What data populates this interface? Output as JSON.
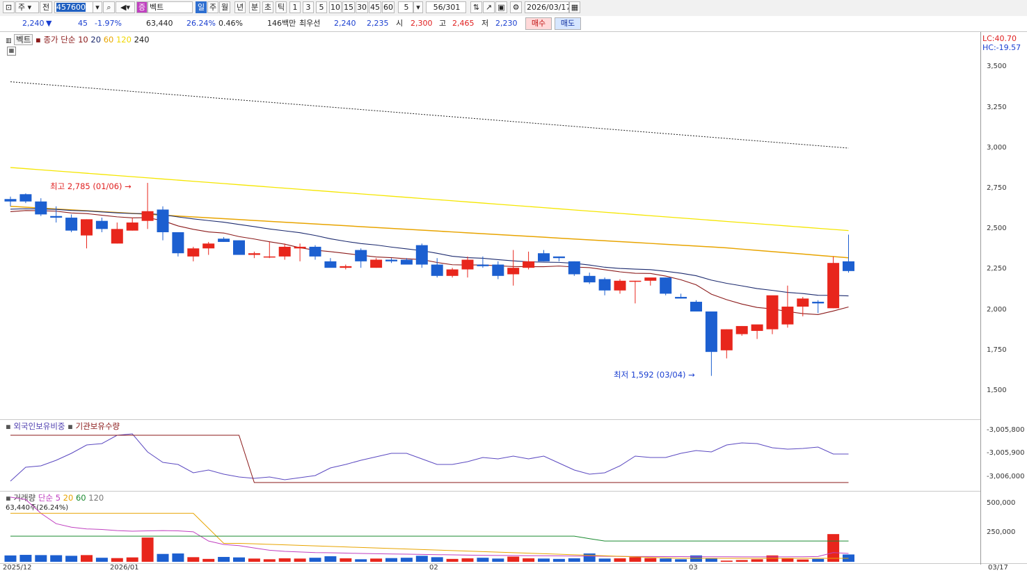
{
  "toolbar": {
    "market": "주",
    "prev_label": "전",
    "code": "457600",
    "name": "벡트",
    "name_prefix": "증",
    "periods": [
      "일",
      "주",
      "월",
      "년",
      "분",
      "초",
      "틱"
    ],
    "intervals": [
      "1",
      "3",
      "5",
      "10",
      "15",
      "30",
      "45",
      "60"
    ],
    "interval_value": "5",
    "count": "56",
    "total": "/301",
    "date": "2026/03/17"
  },
  "quote": {
    "price": "2,240",
    "arrow": "▼",
    "change": "45",
    "change_pct": "-1.97%",
    "volume": "63,440",
    "vol_pct": "26.24%",
    "turnover_pct": "0.46%",
    "amount": "146백만",
    "best_label": "최우선",
    "best_ask": "2,240",
    "best_bid": "2,235",
    "open_label": "시",
    "open": "2,300",
    "high_label": "고",
    "high": "2,465",
    "low_label": "저",
    "low": "2,230",
    "buy_button": "매수",
    "sell_button": "매도"
  },
  "price_panel": {
    "stock_tag": "벡트",
    "ma_label": "종가 단순",
    "ma_periods": [
      "10",
      "20",
      "60",
      "120",
      "240"
    ],
    "ma_colors": [
      "#8b1a1a",
      "#1c2a6e",
      "#e8a400",
      "#f5e000",
      "#222222"
    ],
    "lc": "LC:40.70",
    "hc": "HC:-19.57",
    "max_annotation": "최고 2,785 (01/06)",
    "min_annotation": "최저 1,592 (03/04)",
    "y_labels": [
      "3,500",
      "3,250",
      "3,000",
      "2,750",
      "2,500",
      "2,250",
      "2,000",
      "1,750",
      "1,500"
    ]
  },
  "holding_panel": {
    "series1": "외국인보유비중",
    "series2": "기관보유수량",
    "y_labels": [
      "-3,005,800",
      "-3,005,900",
      "-3,006,000"
    ]
  },
  "volume_panel": {
    "label": "거래량",
    "ma_label": "단순",
    "ma_periods": [
      "5",
      "20",
      "60",
      "120"
    ],
    "current": "63,440주(26.24%)",
    "y_labels": [
      "500,000",
      "250,000"
    ]
  },
  "x_labels": [
    "2025/12",
    "2026/01",
    "02",
    "03",
    "03/17"
  ],
  "chart_data": {
    "type": "candlestick",
    "candles": [
      [
        2685,
        2700,
        2640,
        2670
      ],
      [
        2715,
        2720,
        2660,
        2670
      ],
      [
        2670,
        2690,
        2580,
        2590
      ],
      [
        2580,
        2640,
        2540,
        2570
      ],
      [
        2570,
        2590,
        2480,
        2490
      ],
      [
        2460,
        2560,
        2380,
        2560
      ],
      [
        2550,
        2570,
        2480,
        2500
      ],
      [
        2410,
        2540,
        2410,
        2500
      ],
      [
        2490,
        2570,
        2490,
        2540
      ],
      [
        2550,
        2785,
        2500,
        2610
      ],
      [
        2620,
        2640,
        2430,
        2480
      ],
      [
        2480,
        2480,
        2330,
        2350
      ],
      [
        2330,
        2390,
        2300,
        2380
      ],
      [
        2380,
        2420,
        2340,
        2410
      ],
      [
        2440,
        2450,
        2420,
        2420
      ],
      [
        2430,
        2430,
        2340,
        2340
      ],
      [
        2340,
        2360,
        2320,
        2350
      ],
      [
        2330,
        2420,
        2320,
        2330
      ],
      [
        2330,
        2410,
        2310,
        2390
      ],
      [
        2380,
        2410,
        2300,
        2390
      ],
      [
        2390,
        2400,
        2310,
        2330
      ],
      [
        2300,
        2320,
        2270,
        2260
      ],
      [
        2260,
        2280,
        2250,
        2270
      ],
      [
        2370,
        2380,
        2260,
        2300
      ],
      [
        2260,
        2320,
        2260,
        2310
      ],
      [
        2310,
        2320,
        2290,
        2300
      ],
      [
        2310,
        2320,
        2290,
        2280
      ],
      [
        2400,
        2410,
        2260,
        2280
      ],
      [
        2280,
        2320,
        2200,
        2210
      ],
      [
        2210,
        2260,
        2200,
        2250
      ],
      [
        2250,
        2330,
        2200,
        2310
      ],
      [
        2280,
        2330,
        2260,
        2270
      ],
      [
        2280,
        2300,
        2190,
        2210
      ],
      [
        2220,
        2370,
        2150,
        2260
      ],
      [
        2260,
        2360,
        2250,
        2300
      ],
      [
        2350,
        2370,
        2300,
        2300
      ],
      [
        2330,
        2330,
        2300,
        2320
      ],
      [
        2300,
        2300,
        2210,
        2220
      ],
      [
        2210,
        2230,
        2160,
        2170
      ],
      [
        2190,
        2200,
        2090,
        2120
      ],
      [
        2120,
        2190,
        2100,
        2180
      ],
      [
        2180,
        2180,
        2040,
        2180
      ],
      [
        2180,
        2190,
        2150,
        2200
      ],
      [
        2200,
        2200,
        2090,
        2100
      ],
      [
        2080,
        2100,
        2070,
        2070
      ],
      [
        2050,
        2060,
        1990,
        1990
      ],
      [
        1990,
        1990,
        1592,
        1740
      ],
      [
        1750,
        1880,
        1700,
        1880
      ],
      [
        1850,
        1900,
        1840,
        1900
      ],
      [
        1870,
        1890,
        1820,
        1910
      ],
      [
        1880,
        1880,
        1850,
        2090
      ],
      [
        1910,
        2150,
        1890,
        2020
      ],
      [
        2020,
        2080,
        1960,
        2070
      ],
      [
        2050,
        2060,
        1980,
        2040
      ],
      [
        2010,
        2330,
        2010,
        2290
      ],
      [
        2300,
        2465,
        2230,
        2240
      ]
    ],
    "volume": [
      55000,
      60000,
      58000,
      57000,
      52000,
      58000,
      35000,
      32000,
      38000,
      210000,
      68000,
      72000,
      40000,
      25000,
      42000,
      38000,
      28000,
      22000,
      30000,
      28000,
      35000,
      48000,
      30000,
      22000,
      28000,
      32000,
      35000,
      52000,
      40000,
      25000,
      30000,
      35000,
      28000,
      45000,
      30000,
      28000,
      25000,
      30000,
      72000,
      28000,
      30000,
      40000,
      32000,
      28000,
      22000,
      55000,
      32000,
      10000,
      15000,
      22000,
      55000,
      28000,
      20000,
      25000,
      240000,
      63440
    ],
    "ylim": [
      1450,
      3600
    ]
  }
}
